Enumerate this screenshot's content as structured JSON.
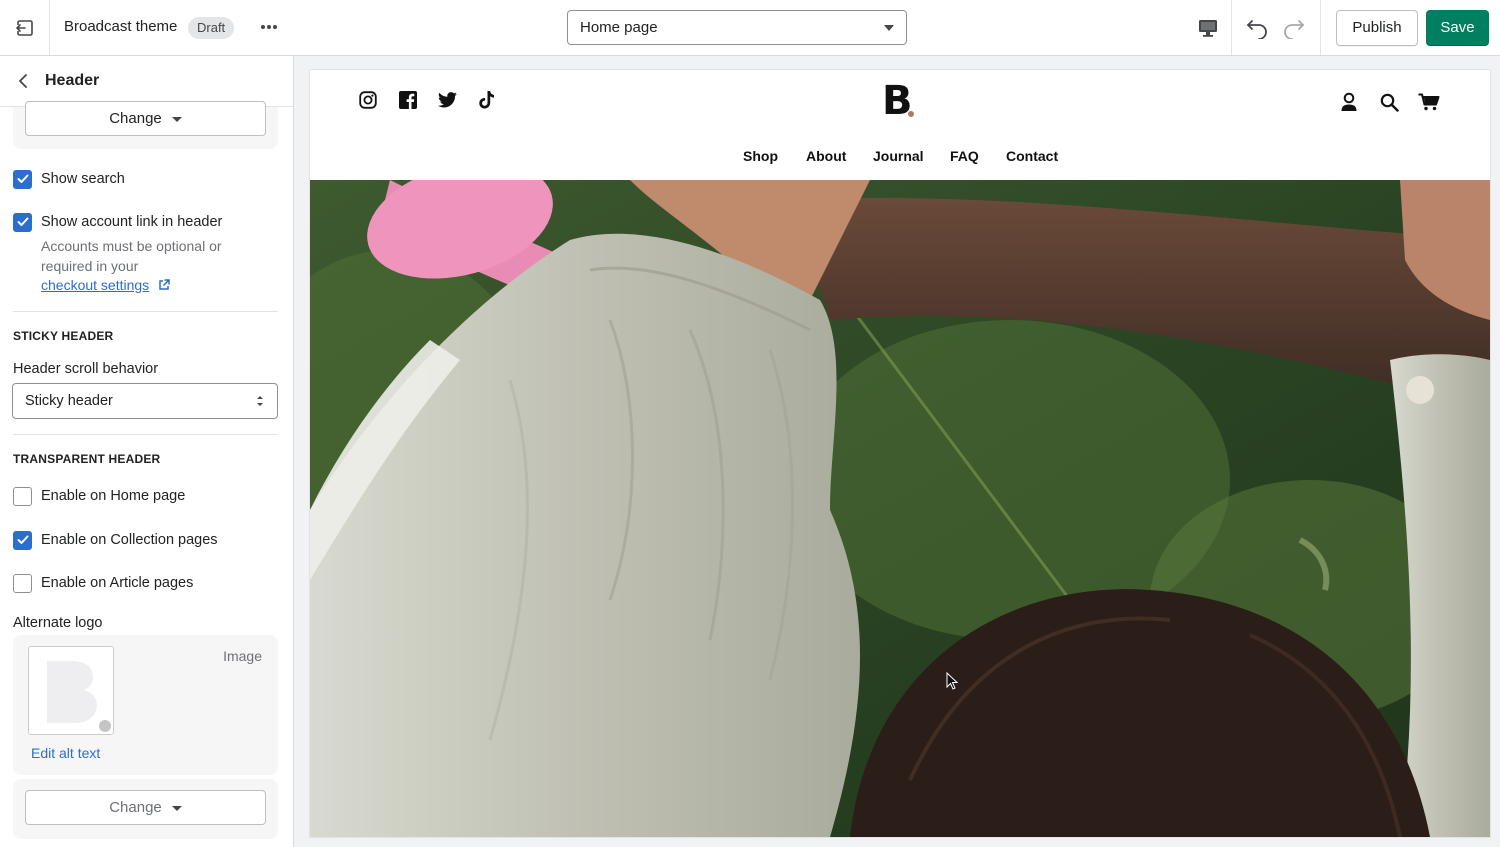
{
  "topbar": {
    "theme_name": "Broadcast theme",
    "status_badge": "Draft",
    "template_select": "Home page",
    "publish_label": "Publish",
    "save_label": "Save",
    "accent": "#008060"
  },
  "sidebar": {
    "title": "Header",
    "logo_change_label": "Change",
    "show_search_label": "Show search",
    "show_search_checked": true,
    "show_account_label": "Show account link in header",
    "show_account_checked": true,
    "account_help_line1": "Accounts must be optional or",
    "account_help_line2": "required in your",
    "checkout_link": "checkout settings",
    "sticky_section": "STICKY HEADER",
    "scroll_label": "Header scroll behavior",
    "scroll_value": "Sticky header",
    "transparent_section": "TRANSPARENT HEADER",
    "enable_home_label": "Enable on Home page",
    "enable_home_checked": false,
    "enable_collection_label": "Enable on Collection pages",
    "enable_collection_checked": true,
    "enable_article_label": "Enable on Article pages",
    "enable_article_checked": false,
    "alt_logo_label": "Alternate logo",
    "image_type": "Image",
    "edit_alt_text": "Edit alt text",
    "alt_change_label": "Change"
  },
  "preview": {
    "logo_text": "B",
    "social_icons": [
      "instagram-icon",
      "facebook-icon",
      "twitter-icon",
      "tiktok-icon"
    ],
    "nav": [
      "Shop",
      "About",
      "Journal",
      "FAQ",
      "Contact"
    ]
  }
}
